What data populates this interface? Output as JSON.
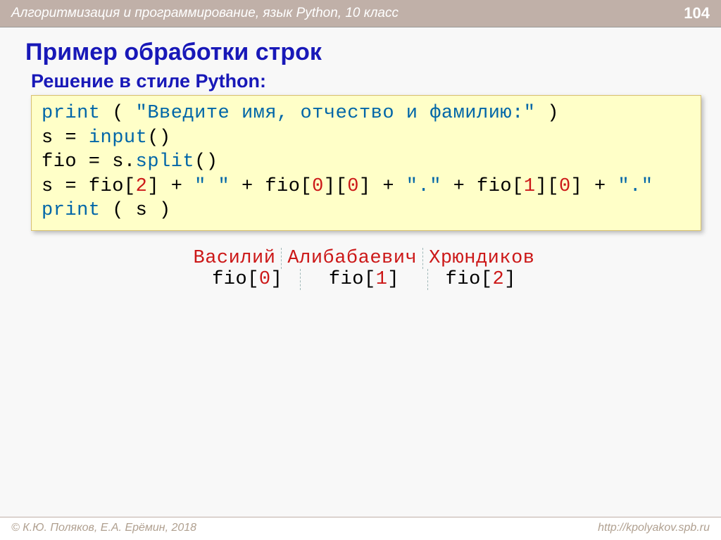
{
  "header": {
    "course": "Алгоритмизация и программирование, язык Python, 10 класс",
    "page": "104"
  },
  "title": "Пример обработки строк",
  "subtitle": "Решение в стиле Python:",
  "code": {
    "l1_print": "print",
    "l1_paren_open": " ( ",
    "l1_str": "\"Введите имя, отчество и фамилию:\"",
    "l1_paren_close": " )",
    "l2_s": "s",
    "l2_eq": " = ",
    "l2_input": "input",
    "l2_parens": "()",
    "l3_fio": "fio",
    "l3_eq": " = ",
    "l3_s": "s",
    "l3_dot": ".",
    "l3_split": "split",
    "l3_parens": "()",
    "l4_a": "s",
    "l4_eq": " = ",
    "l4_b": "fio[",
    "l4_n2": "2",
    "l4_c": "] + ",
    "l4_sp": "\" \"",
    "l4_d": " + fio[",
    "l4_n0a": "0",
    "l4_e": "][",
    "l4_n0b": "0",
    "l4_f": "] + ",
    "l4_dot1": "\".\"",
    "l4_g": " + fio[",
    "l4_n1": "1",
    "l4_h": "][",
    "l4_n0c": "0",
    "l4_i": "] + ",
    "l4_dot2": "\".\"",
    "l5_print": "print",
    "l5_rest": " ( s )"
  },
  "example": {
    "names": [
      "Василий",
      "Алибабаевич",
      "Хрюндиков"
    ],
    "idx": {
      "pre": "fio[",
      "post": "]",
      "nums": [
        "0",
        "1",
        "2"
      ]
    }
  },
  "footer": {
    "left": "© К.Ю. Поляков, Е.А. Ерёмин, 2018",
    "right": "http://kpolyakov.spb.ru"
  }
}
